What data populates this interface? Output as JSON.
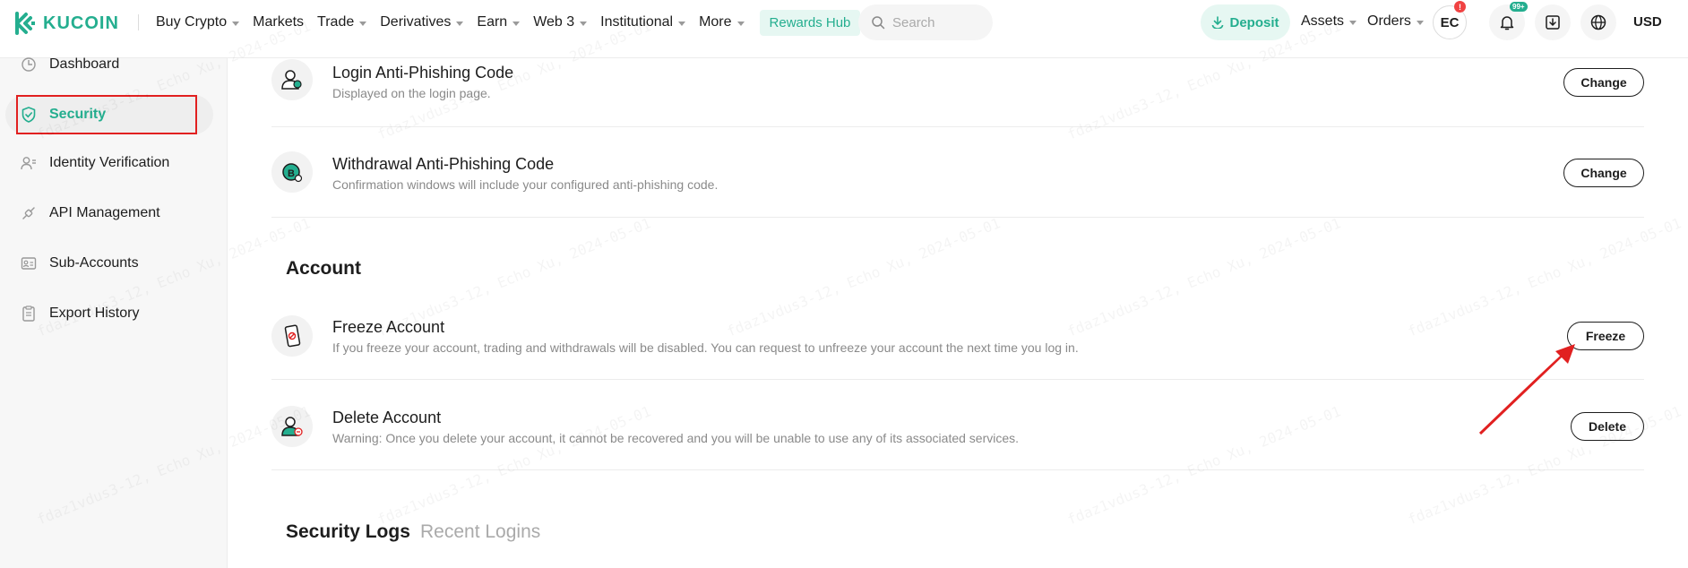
{
  "brand": {
    "logo_text": "KUCOIN",
    "accent_color": "#24ae8f"
  },
  "nav": {
    "items": [
      {
        "label": "Buy Crypto",
        "has_caret": true
      },
      {
        "label": "Markets",
        "has_caret": false
      },
      {
        "label": "Trade",
        "has_caret": true
      },
      {
        "label": "Derivatives",
        "has_caret": true
      },
      {
        "label": "Earn",
        "has_caret": true
      },
      {
        "label": "Web 3",
        "has_caret": true
      },
      {
        "label": "Institutional",
        "has_caret": true
      },
      {
        "label": "More",
        "has_caret": true
      }
    ],
    "rewards_label": "Rewards Hub",
    "search_placeholder": "Search"
  },
  "header_right": {
    "deposit_label": "Deposit",
    "assets_label": "Assets",
    "orders_label": "Orders",
    "avatar_initials": "EC",
    "avatar_badge": "!",
    "notification_badge": "99+",
    "currency": "USD"
  },
  "sidebar": {
    "items": [
      {
        "label": "Dashboard",
        "icon": "dashboard-icon"
      },
      {
        "label": "Security",
        "icon": "shield-icon",
        "active": true
      },
      {
        "label": "Identity Verification",
        "icon": "user-id-icon"
      },
      {
        "label": "API Management",
        "icon": "api-icon"
      },
      {
        "label": "Sub-Accounts",
        "icon": "sub-accounts-icon"
      },
      {
        "label": "Export History",
        "icon": "export-icon"
      }
    ]
  },
  "main": {
    "rows_top": [
      {
        "title": "Login Anti-Phishing Code",
        "desc": "Displayed on the login page.",
        "button": "Change"
      },
      {
        "title": "Withdrawal Anti-Phishing Code",
        "desc": "Confirmation windows will include your configured anti-phishing code.",
        "button": "Change"
      }
    ],
    "account_section_title": "Account",
    "account_rows": [
      {
        "title": "Freeze Account",
        "desc": "If you freeze your account, trading and withdrawals will be disabled. You can request to unfreeze your account the next time you log in.",
        "button": "Freeze"
      },
      {
        "title": "Delete Account",
        "desc": "Warning: Once you delete your account, it cannot be recovered and you will be unable to use any of its associated services.",
        "button": "Delete"
      }
    ],
    "tabs": [
      {
        "label": "Security Logs",
        "active": true
      },
      {
        "label": "Recent Logins",
        "active": false
      }
    ]
  },
  "watermark_text": "fdaz1vdus3-12, Echo Xu, 2024-05-01",
  "annotation_color": "#e12020"
}
